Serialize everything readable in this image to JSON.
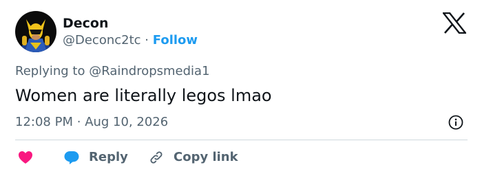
{
  "author": {
    "display_name": "Decon",
    "handle": "@Deconc2tc",
    "separator": "·",
    "follow_label": "Follow"
  },
  "reply_context": {
    "prefix": "Replying to",
    "mention": "@Raindropsmedia1"
  },
  "tweet": {
    "text": "Women are literally legos lmao",
    "time": "12:08 PM",
    "separator": "·",
    "date": "Aug 10, 2026"
  },
  "actions": {
    "like_icon": "heart-icon",
    "reply_label": "Reply",
    "copy_link_label": "Copy link"
  },
  "colors": {
    "accent": "#1d9bf0",
    "heart": "#f91880",
    "secondary_text": "#536471",
    "divider": "#cfd9de"
  },
  "icons": [
    "x-logo-icon",
    "info-icon",
    "heart-icon",
    "reply-bubble-icon",
    "link-icon"
  ]
}
